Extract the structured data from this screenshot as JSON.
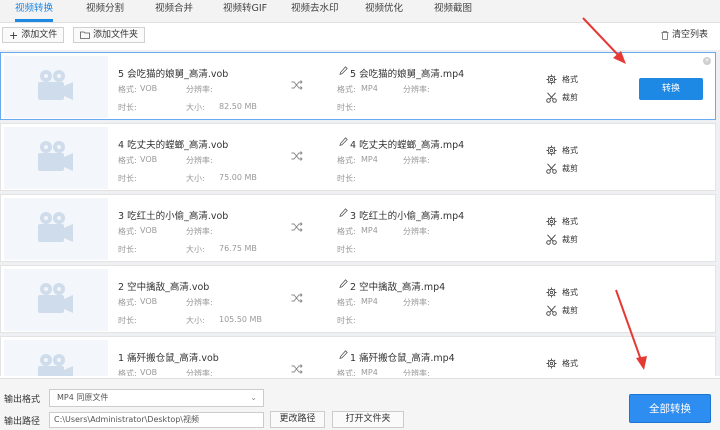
{
  "tabs": [
    "视频转换",
    "视频分割",
    "视频合并",
    "视频转GIF",
    "视频去水印",
    "视频优化",
    "视频截图"
  ],
  "toolbar": {
    "add_file": "添加文件",
    "add_folder": "添加文件夹",
    "clear_list": "清空列表"
  },
  "labels": {
    "format": "格式:",
    "resolution": "分辨率:",
    "duration": "时长:",
    "size": "大小:"
  },
  "actions": {
    "format": "格式",
    "crop": "裁剪",
    "convert": "转换"
  },
  "files": [
    {
      "source": "5 会吃猫的娘舅_高清.vob",
      "src_format": "VOB",
      "src_size": "82.50 MB",
      "target": "5 会吃猫的娘舅_高清.mp4",
      "dst_format": "MP4"
    },
    {
      "source": "4 吃丈夫的螳螂_高清.vob",
      "src_format": "VOB",
      "src_size": "75.00 MB",
      "target": "4 吃丈夫的螳螂_高清.mp4",
      "dst_format": "MP4"
    },
    {
      "source": "3 吃红土的小偷_高清.vob",
      "src_format": "VOB",
      "src_size": "76.75 MB",
      "target": "3 吃红土的小偷_高清.mp4",
      "dst_format": "MP4"
    },
    {
      "source": "2 空中擒敌_高清.vob",
      "src_format": "VOB",
      "src_size": "105.50 MB",
      "target": "2 空中擒敌_高清.mp4",
      "dst_format": "MP4"
    },
    {
      "source": "1 痛歼搬仓鼠_高清.vob",
      "src_format": "VOB",
      "src_size": "",
      "target": "1 痛歼搬仓鼠_高清.mp4",
      "dst_format": "MP4"
    }
  ],
  "bottom": {
    "output_format_label": "输出格式",
    "output_format_value": "MP4  同原文件",
    "output_path_label": "输出路径",
    "output_path_value": "C:\\Users\\Administrator\\Desktop\\视频",
    "change_path": "更改路径",
    "open_folder": "打开文件夹",
    "convert_all": "全部转换"
  },
  "colors": {
    "accent": "#1e88e5",
    "annotation_arrow": "#e53935"
  }
}
